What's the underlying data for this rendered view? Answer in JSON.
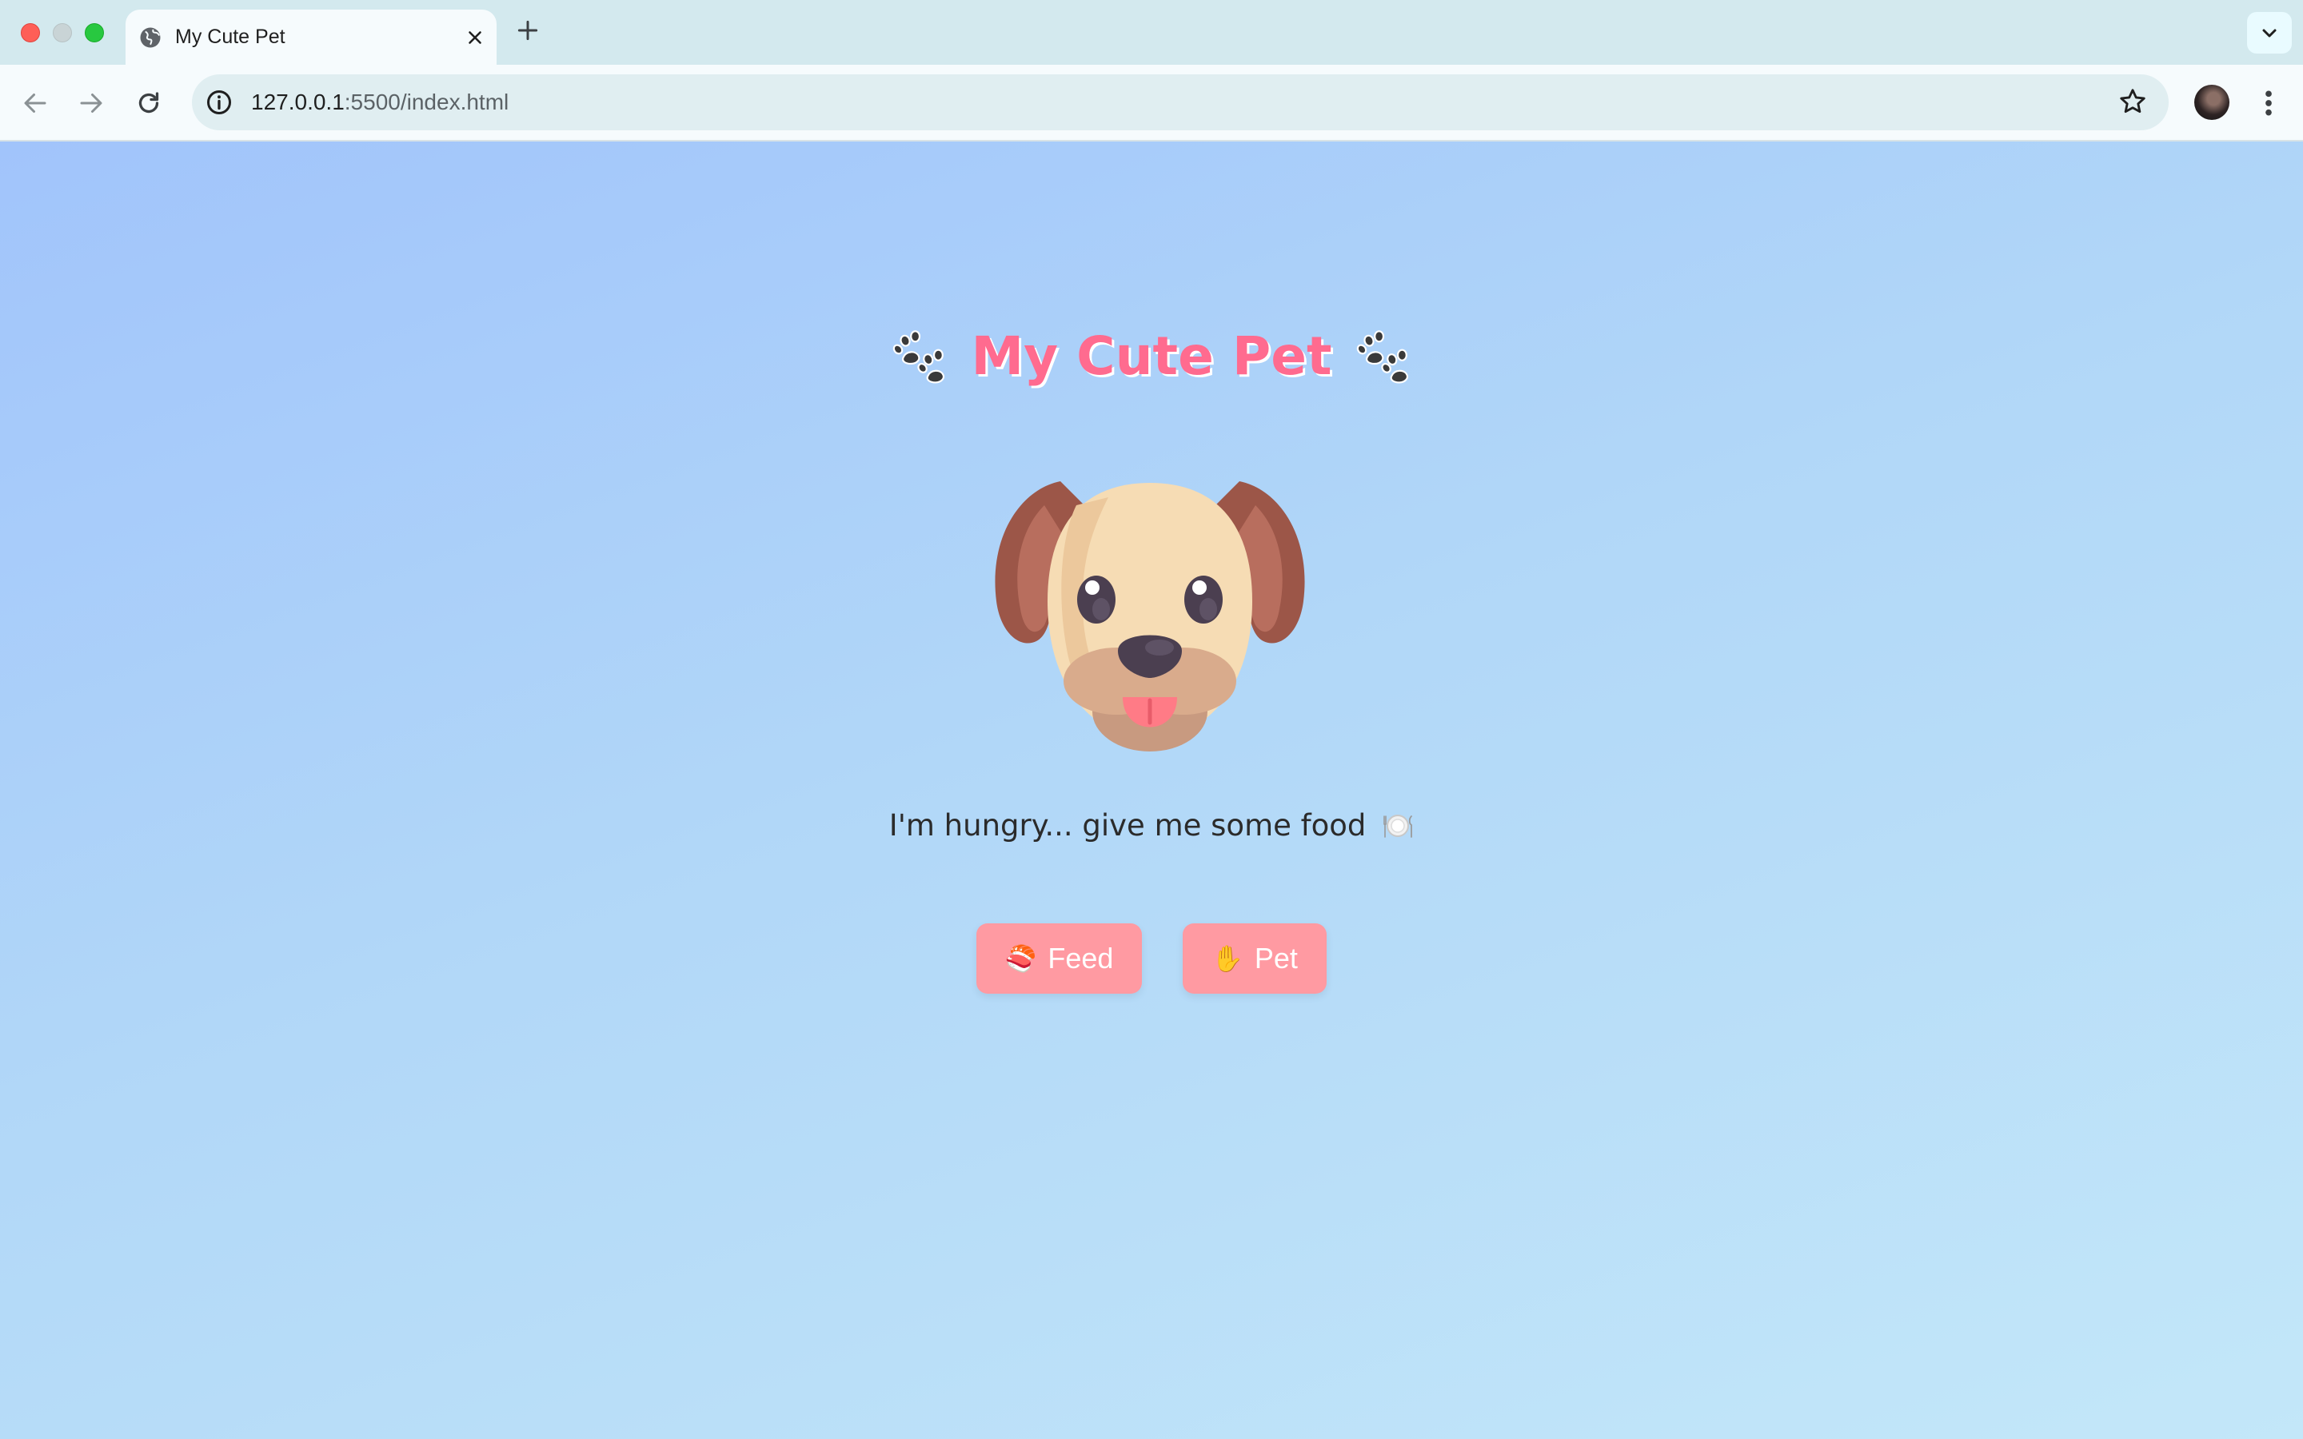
{
  "browser": {
    "tab_title": "My Cute Pet",
    "url_host": "127.0.0.1",
    "url_path": ":5500/index.html"
  },
  "page": {
    "title": "My Cute Pet",
    "status_message": "I'm hungry... give me some food",
    "buttons": {
      "feed_label": "Feed",
      "feed_emoji": "🍣",
      "pet_label": "Pet",
      "pet_emoji": "✋"
    },
    "colors": {
      "title": "#ff6b8f",
      "button_bg": "#ff9aa2",
      "background_start": "#a1c4fb",
      "background_end": "#c3e7f9"
    },
    "icons": {
      "title_decoration": "paw-prints-icon",
      "status_decoration": "plate-icon",
      "pet_illustration": "dog-face-illustration"
    }
  }
}
